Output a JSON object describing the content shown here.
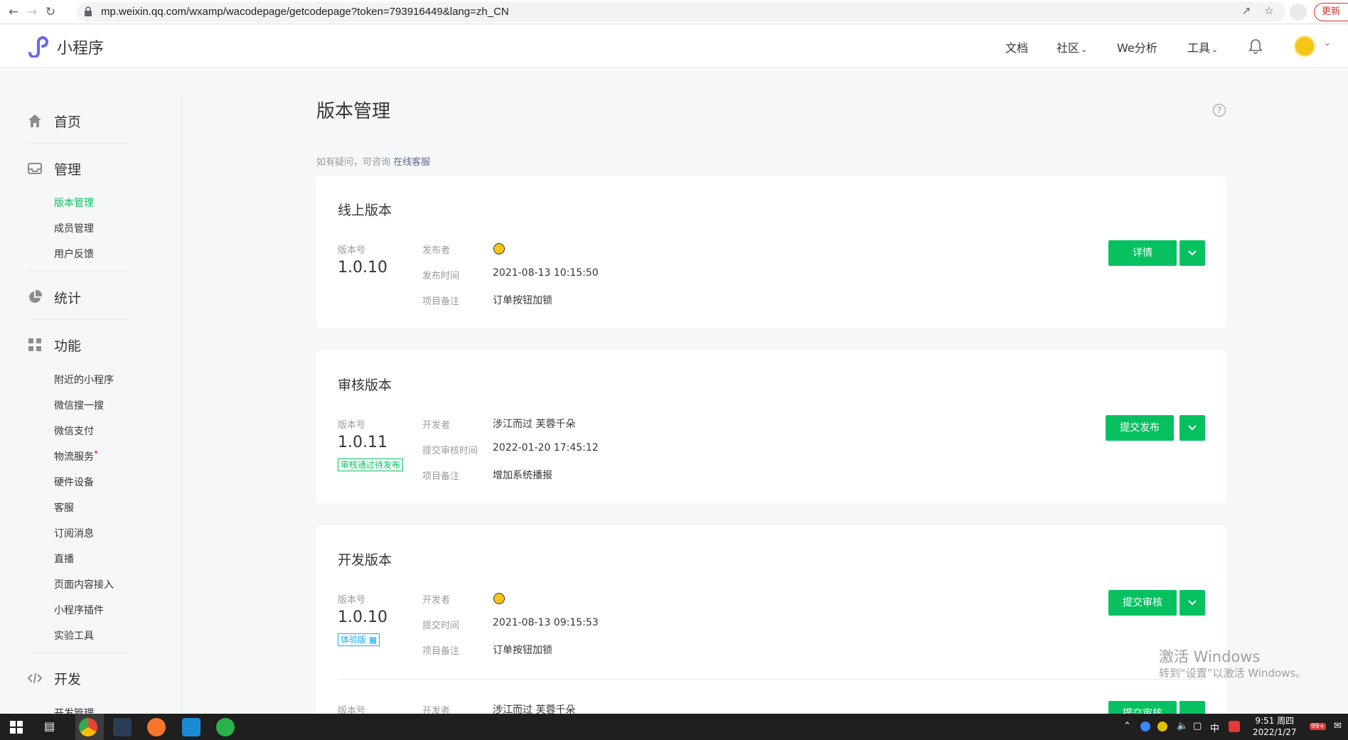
{
  "browser": {
    "url": "mp.weixin.qq.com/wxamp/wacodepage/getcodepage?token=793916449&lang=zh_CN",
    "update_label": "更新"
  },
  "header": {
    "logo_text": "小程序",
    "nav": [
      "文档",
      "社区",
      "We分析",
      "工具"
    ]
  },
  "sidebar": {
    "groups": [
      {
        "label": "首页",
        "icon": "home-icon"
      },
      {
        "label": "管理",
        "icon": "inbox-icon",
        "items": [
          "版本管理",
          "成员管理",
          "用户反馈"
        ]
      },
      {
        "label": "统计",
        "icon": "pie-chart-icon"
      },
      {
        "label": "功能",
        "icon": "grid-icon",
        "items": [
          "附近的小程序",
          "微信搜一搜",
          "微信支付",
          "物流服务",
          "硬件设备",
          "客服",
          "订阅消息",
          "直播",
          "页面内容接入",
          "小程序插件",
          "实验工具"
        ]
      },
      {
        "label": "开发",
        "icon": "code-icon",
        "items": [
          "开发管理"
        ]
      }
    ],
    "active_item": "版本管理"
  },
  "main": {
    "title": "版本管理",
    "hint": "如有疑问，可咨询",
    "hint_link": "在线客服",
    "cards": [
      {
        "title": "线上版本",
        "version_label": "版本号",
        "version": "1.0.10",
        "fields": [
          {
            "label": "发布者",
            "value": ""
          },
          {
            "label": "发布时间",
            "value": "2021-08-13 10:15:50"
          },
          {
            "label": "项目备注",
            "value": "订单按钮加锁"
          }
        ],
        "button": "详情"
      },
      {
        "title": "审核版本",
        "version_label": "版本号",
        "version": "1.0.11",
        "tag": "审核通过待发布",
        "fields": [
          {
            "label": "开发者",
            "value": "涉江而过 芙蓉千朵"
          },
          {
            "label": "提交审核时间",
            "value": "2022-01-20 17:45:12"
          },
          {
            "label": "项目备注",
            "value": "增加系统播报"
          }
        ],
        "button": "提交发布"
      },
      {
        "title": "开发版本",
        "version_label": "版本号",
        "version": "1.0.10",
        "tag": "体验版",
        "fields": [
          {
            "label": "开发者",
            "value": ""
          },
          {
            "label": "提交时间",
            "value": "2021-08-13 09:15:53"
          },
          {
            "label": "项目备注",
            "value": "订单按钮加锁"
          }
        ],
        "button": "提交审核",
        "next_row": {
          "version_label": "版本号",
          "dev_label": "开发者",
          "dev_value": "涉江而过 芙蓉千朵",
          "button": "提交审核"
        }
      }
    ]
  },
  "watermark": {
    "line1": "激活 Windows",
    "line2": "转到“设置”以激活 Windows。"
  },
  "taskbar": {
    "ime": "中",
    "badge": "99+",
    "time": "9:51 周四",
    "date": "2022/1/27"
  },
  "colors": {
    "brand": "#07c160",
    "link": "#576b95",
    "tag_blue": "#10aeff"
  }
}
